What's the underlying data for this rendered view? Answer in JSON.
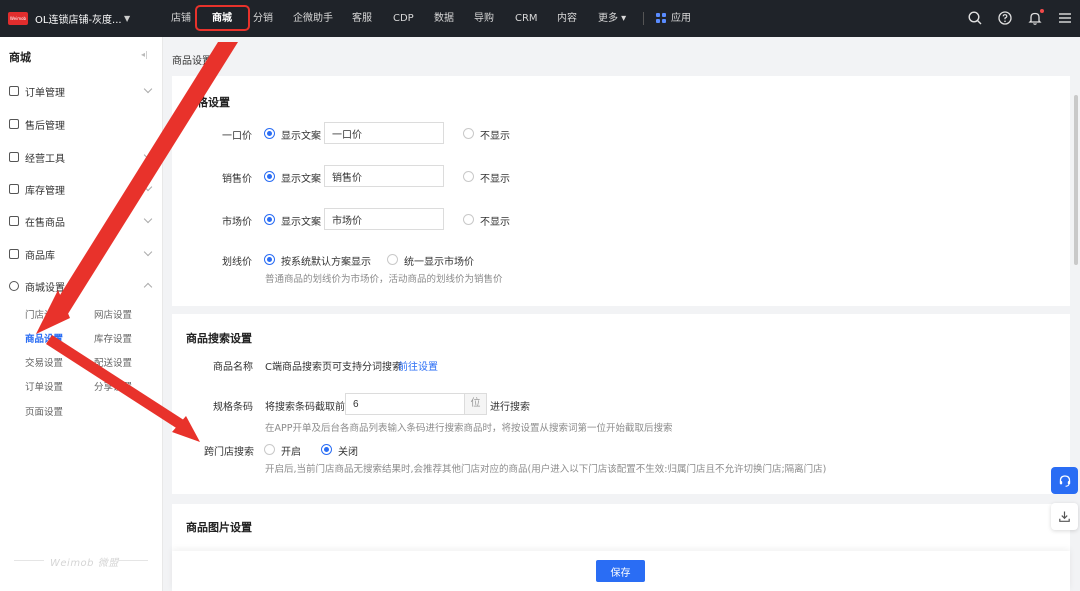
{
  "topbar": {
    "store_name": "OL连锁店铺-灰度...",
    "nav": [
      {
        "label": "店铺"
      },
      {
        "label": "商城"
      },
      {
        "label": "分销"
      },
      {
        "label": "企微助手"
      },
      {
        "label": "客服"
      },
      {
        "label": "CDP"
      },
      {
        "label": "数据"
      },
      {
        "label": "导购"
      },
      {
        "label": "CRM"
      },
      {
        "label": "内容"
      },
      {
        "label": "更多 ▾"
      }
    ],
    "apps_label": "应用",
    "accent_color": "#2a6df4",
    "highlight_color": "#e8322b"
  },
  "sidebar": {
    "title": "商城",
    "items": [
      {
        "label": "订单管理"
      },
      {
        "label": "售后管理"
      },
      {
        "label": "经营工具"
      },
      {
        "label": "库存管理"
      },
      {
        "label": "在售商品"
      },
      {
        "label": "商品库"
      },
      {
        "label": "商城设置"
      }
    ],
    "sub_items": [
      {
        "label": "门店设置"
      },
      {
        "label": "网店设置"
      },
      {
        "label": "商品设置"
      },
      {
        "label": "库存设置"
      },
      {
        "label": "交易设置"
      },
      {
        "label": "配送设置"
      },
      {
        "label": "订单设置"
      },
      {
        "label": "分享设置"
      },
      {
        "label": "页面设置"
      }
    ],
    "watermark": "Weimob 微盟"
  },
  "breadcrumb": "商品设置",
  "price_panel": {
    "title": "价格设置",
    "rows": [
      {
        "label": "一口价",
        "show_text": "显示文案",
        "value": "一口价",
        "hide_text": "不显示"
      },
      {
        "label": "销售价",
        "show_text": "显示文案",
        "value": "销售价",
        "hide_text": "不显示"
      },
      {
        "label": "市场价",
        "show_text": "显示文案",
        "value": "市场价",
        "hide_text": "不显示"
      }
    ],
    "strike": {
      "label": "划线价",
      "opt1": "按系统默认方案显示",
      "opt2": "统一显示市场价",
      "hint": "普通商品的划线价为市场价，活动商品的划线价为销售价"
    }
  },
  "search_panel": {
    "title": "商品搜索设置",
    "name_label": "商品名称",
    "name_text": "C端商品搜索页可支持分词搜索",
    "name_link": "前往设置",
    "barcode_label": "规格条码",
    "barcode_prefix": "将搜索条码截取前",
    "barcode_value": "6",
    "barcode_unit": "位",
    "barcode_suffix": "进行搜索",
    "barcode_hint": "在APP开单及后台各商品列表输入条码进行搜索商品时，将按设置从搜索词第一位开始截取后搜索",
    "cross_label": "跨门店搜索",
    "cross_on": "开启",
    "cross_off": "关闭",
    "cross_hint": "开启后,当前门店商品无搜索结果时,会推荐其他门店对应的商品(用户进入以下门店该配置不生效:归属门店且不允许切换门店;隔离门店)"
  },
  "image_panel": {
    "title": "商品图片设置"
  },
  "footer": {
    "save_label": "保存"
  }
}
